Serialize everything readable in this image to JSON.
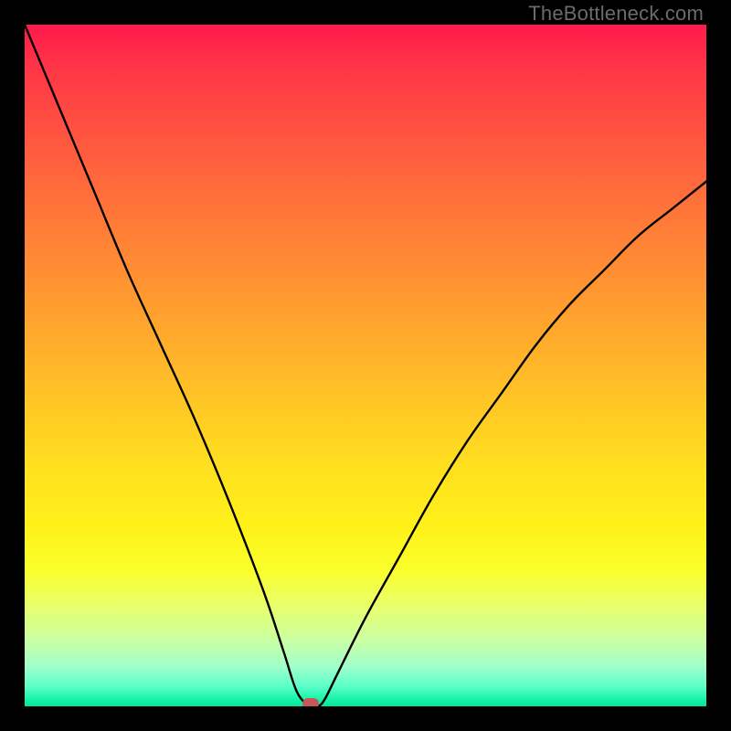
{
  "watermark": "TheBottleneck.com",
  "colors": {
    "frame": "#000000",
    "watermark": "#6b6b6b",
    "curve": "#000000",
    "marker": "#c9575a"
  },
  "chart_data": {
    "type": "line",
    "title": "",
    "xlabel": "",
    "ylabel": "",
    "xlim": [
      0,
      100
    ],
    "ylim": [
      0,
      100
    ],
    "grid": false,
    "background_gradient": {
      "top_color": "#ff1a4b",
      "bottom_color": "#00e69a",
      "meaning": "red=high bottleneck, green=low bottleneck"
    },
    "series": [
      {
        "name": "bottleneck-curve",
        "description": "V-shaped bottleneck percentage vs component performance; minimum of left and right branches",
        "x": [
          0,
          5,
          10,
          15,
          20,
          25,
          30,
          35,
          38,
          40,
          42,
          43,
          44,
          46,
          50,
          55,
          60,
          65,
          70,
          75,
          80,
          85,
          90,
          95,
          100
        ],
        "values": [
          100,
          88,
          76,
          64,
          53,
          42,
          30,
          17,
          8,
          2,
          0,
          0,
          1,
          5,
          13,
          22,
          31,
          39,
          46,
          53,
          59,
          64,
          69,
          73,
          77
        ]
      }
    ],
    "marker": {
      "description": "optimal / selected configuration point",
      "x": 42,
      "y": 0,
      "color": "#c9575a"
    }
  }
}
